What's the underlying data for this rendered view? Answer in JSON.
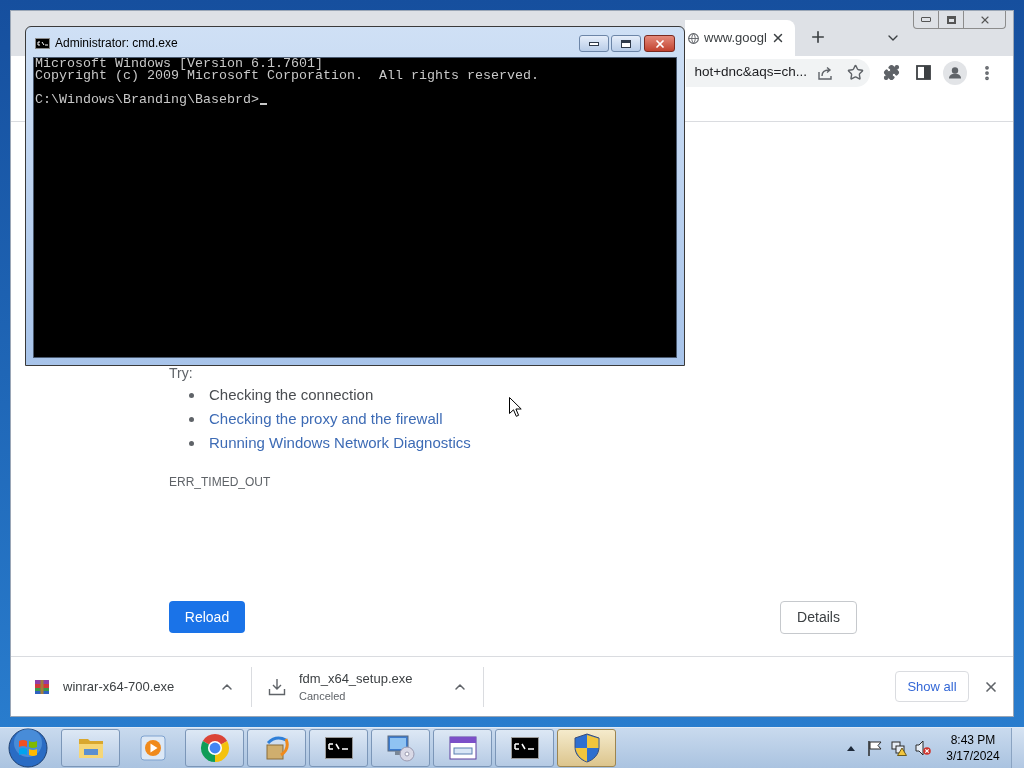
{
  "browser": {
    "tabs": [
      {
        "title": "www.googl",
        "selected": true
      }
    ],
    "address_bar": {
      "value": "hot+dnc&aqs=ch..."
    },
    "page": {
      "try_label": "Try:",
      "suggestions": [
        {
          "text": "Checking the connection",
          "kind": "text"
        },
        {
          "text": "Checking the proxy and the firewall",
          "kind": "link"
        },
        {
          "text": "Running Windows Network Diagnostics",
          "kind": "link"
        }
      ],
      "error_code": "ERR_TIMED_OUT",
      "buttons": [
        {
          "label": "Reload",
          "kind": "primary"
        },
        {
          "label": "Details",
          "kind": "secondary"
        }
      ]
    },
    "downloads": {
      "items": [
        {
          "filename": "winrar-x64-700.exe",
          "kind": "archive"
        },
        {
          "filename": "fdm_x64_setup.exe",
          "status": "Canceled",
          "kind": "canceled"
        }
      ],
      "show_all": "Show all"
    }
  },
  "cmd_window": {
    "title": "Administrator: cmd.exe",
    "output": [
      "Microsoft Windows [Version 6.1.7601]",
      "Copyright (c) 2009 Microsoft Corporation.  All rights reserved."
    ],
    "prompt": "C:\\Windows\\Branding\\Basebrd>"
  },
  "taskbar": {
    "buttons": [
      {
        "kind": "folder",
        "running": true,
        "active": false
      },
      {
        "kind": "media",
        "running": false,
        "active": false
      },
      {
        "kind": "browser",
        "running": true,
        "active": false
      },
      {
        "kind": "setup",
        "running": true,
        "active": false
      },
      {
        "kind": "terminal",
        "running": true,
        "active": false
      },
      {
        "kind": "computer-disc",
        "running": true,
        "active": false
      },
      {
        "kind": "window",
        "running": true,
        "active": false
      },
      {
        "kind": "terminal",
        "running": true,
        "active": false
      },
      {
        "kind": "shield",
        "running": true,
        "active": true
      }
    ],
    "clock": {
      "time": "8:43 PM",
      "date": "3/17/2024"
    }
  }
}
